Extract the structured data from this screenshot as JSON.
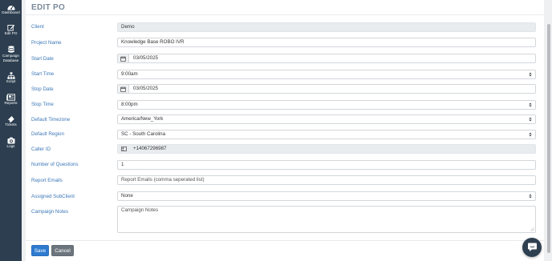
{
  "sidebar": {
    "items": [
      {
        "label": "Dashboard",
        "icon": "dashboard-icon"
      },
      {
        "label": "Edit PO",
        "icon": "edit-icon"
      },
      {
        "label": "Campaign Database",
        "label_line1": "Campaign",
        "label_line2": "Database",
        "icon": "database-icon"
      },
      {
        "label": "Script",
        "icon": "sitemap-icon"
      },
      {
        "label": "Reports",
        "icon": "newspaper-icon"
      },
      {
        "label": "Tickets",
        "icon": "ticket-icon"
      },
      {
        "label": "Logs",
        "icon": "camera-icon"
      }
    ]
  },
  "page": {
    "title": "EDIT PO"
  },
  "form": {
    "client": {
      "label": "Client",
      "value": "Demo"
    },
    "project_name": {
      "label": "Project Name",
      "value": "Knowledge Base ROBO IVR"
    },
    "start_date": {
      "label": "Start Date",
      "value": "03/05/2025"
    },
    "start_time": {
      "label": "Start Time",
      "value": "9:00am"
    },
    "stop_date": {
      "label": "Stop Date",
      "value": "03/05/2025"
    },
    "stop_time": {
      "label": "Stop Time",
      "value": "8:00pm"
    },
    "default_timezone": {
      "label": "Default Timezone",
      "value": "America/New_York"
    },
    "default_region": {
      "label": "Default Region",
      "value": "SC - South Carolina"
    },
    "caller_id": {
      "label": "Caller ID",
      "value": "+14067296987"
    },
    "number_of_questions": {
      "label": "Number of Questions",
      "value": "1"
    },
    "report_emails": {
      "label": "Report Emails",
      "value": "",
      "placeholder": "Report Emails (comma seperated list)"
    },
    "assigned_subclient": {
      "label": "Assigned SubClient",
      "value": "None"
    },
    "campaign_notes": {
      "label": "Campaign Notes",
      "value": "",
      "placeholder": "Campaign Notes"
    }
  },
  "buttons": {
    "save": "Save",
    "cancel": "Cancel"
  },
  "colors": {
    "sidebar_bg": "#2c3e50",
    "label_blue": "#3d78b8",
    "save_blue": "#2f7bd0",
    "cancel_gray": "#6c757d",
    "chat_bg": "#2e3f50"
  }
}
